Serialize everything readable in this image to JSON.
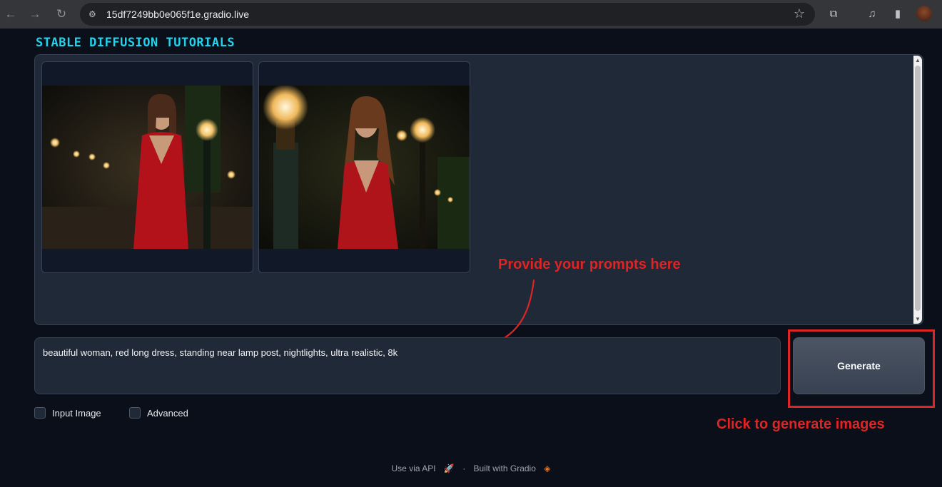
{
  "browser": {
    "url": "15df7249bb0e065f1e.gradio.live"
  },
  "app": {
    "title": "STABLE DIFFUSION TUTORIALS"
  },
  "prompt": {
    "value": "beautiful woman, red long dress, standing near lamp post, nightlights, ultra realistic, 8k"
  },
  "generate_button": {
    "label": "Generate"
  },
  "options": {
    "input_image_label": "Input Image",
    "advanced_label": "Advanced"
  },
  "annotations": {
    "prompt_hint": "Provide your prompts here",
    "generate_hint": "Click to generate images"
  },
  "footer": {
    "use_api": "Use via API",
    "separator": "·",
    "built_with": "Built with Gradio"
  },
  "colors": {
    "accent_title": "#22d3ee",
    "annotation_red": "#dc2626",
    "background": "#0b0f19"
  },
  "gallery": {
    "images": [
      {
        "description_icon": "image-woman-red-dress-lamp-post-1"
      },
      {
        "description_icon": "image-woman-red-dress-lamp-post-2"
      }
    ]
  }
}
